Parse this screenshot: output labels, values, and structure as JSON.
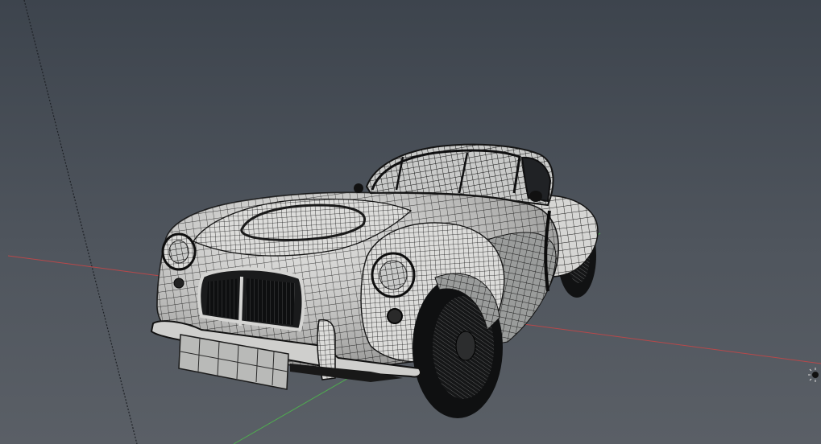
{
  "viewport": {
    "label": "",
    "background_top": "#3d444d",
    "background_bottom": "#5a5f66"
  },
  "axes": {
    "x_color": "#b8484a",
    "y_color": "#4fae4f",
    "camera_line_color": "#1e2126"
  },
  "model": {
    "display_mode": "wireframe-on-shaded",
    "surface_color": "#d8d8d6",
    "shadow_color": "#8f918f",
    "wire_color": "#1a1a1a",
    "glass_color": "#202225"
  },
  "widgets": {
    "light_icon": "sun-light-icon"
  }
}
